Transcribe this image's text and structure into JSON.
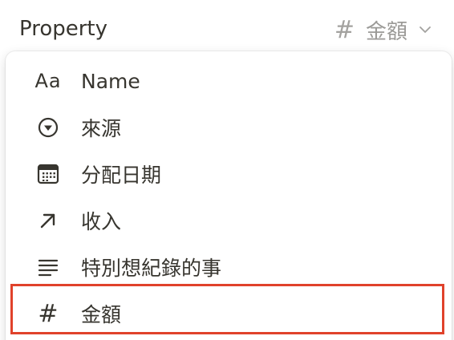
{
  "header": {
    "label": "Property",
    "value_hash": "#",
    "value_text": "金額"
  },
  "menu": {
    "items": [
      {
        "label": "Name",
        "icon": "text-aa-icon"
      },
      {
        "label": "來源",
        "icon": "select-circle-icon"
      },
      {
        "label": "分配日期",
        "icon": "calendar-icon"
      },
      {
        "label": "收入",
        "icon": "arrow-up-right-icon"
      },
      {
        "label": "特別想紀錄的事",
        "icon": "lines-icon"
      },
      {
        "label": "金額",
        "icon": "hash-icon"
      }
    ],
    "aa_glyph": "Aa",
    "hash_glyph": "#"
  },
  "colors": {
    "text": "#37352f",
    "muted": "#9b9a97",
    "highlight": "#e0422b"
  }
}
